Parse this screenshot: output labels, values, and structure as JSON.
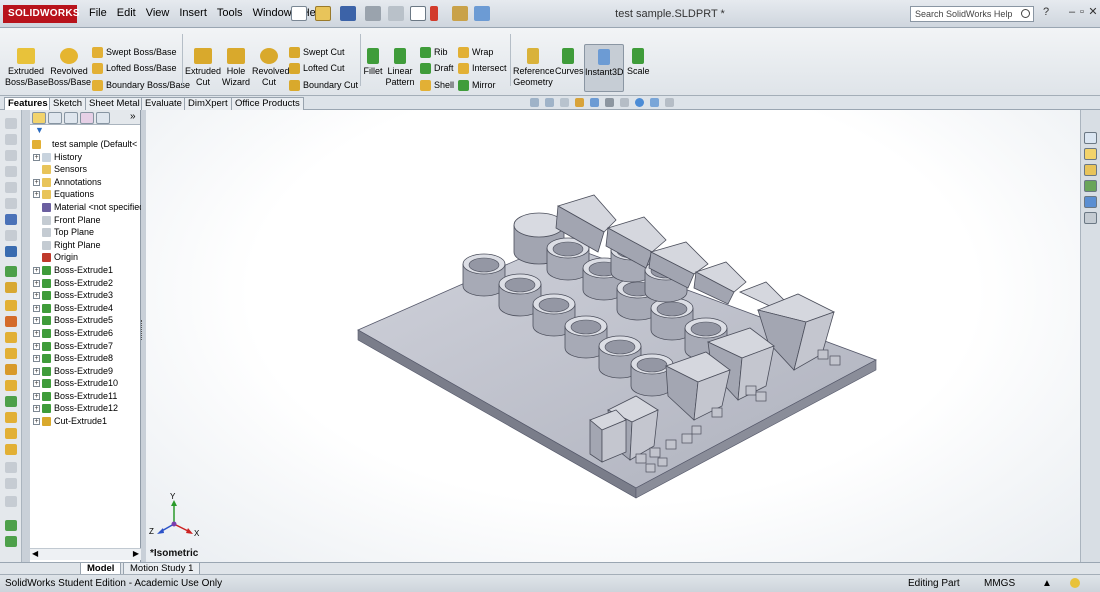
{
  "app": {
    "logo_text": "SOLIDWORKS",
    "document_title": "test sample.SLDPRT *",
    "menus": [
      "File",
      "Edit",
      "View",
      "Insert",
      "Tools",
      "Window",
      "Help"
    ],
    "help_search_placeholder": "Search SolidWorks Help"
  },
  "command_manager": {
    "extruded_boss": "Extruded Boss/Base",
    "revolved_boss": "Revolved Boss/Base",
    "swept_boss": "Swept Boss/Base",
    "lofted_boss": "Lofted Boss/Base",
    "boundary_boss": "Boundary Boss/Base",
    "extruded_cut": "Extruded Cut",
    "hole_wizard": "Hole Wizard",
    "revolved_cut": "Revolved Cut",
    "swept_cut": "Swept Cut",
    "lofted_cut": "Lofted Cut",
    "boundary_cut": "Boundary Cut",
    "fillet": "Fillet",
    "linear_pattern": "Linear Pattern",
    "rib": "Rib",
    "draft": "Draft",
    "shell": "Shell",
    "wrap": "Wrap",
    "intersect": "Intersect",
    "mirror": "Mirror",
    "reference_geometry": "Reference Geometry",
    "curves": "Curves",
    "instant3d": "Instant3D",
    "scale": "Scale"
  },
  "tabs": [
    "Features",
    "Sketch",
    "Sheet Metal",
    "Evaluate",
    "DimXpert",
    "Office Products"
  ],
  "feature_tree": {
    "root": "test sample  (Default<",
    "items": [
      {
        "label": "History",
        "icon": "history-icon",
        "expand": true
      },
      {
        "label": "Sensors",
        "icon": "sensors-icon",
        "expand": false
      },
      {
        "label": "Annotations",
        "icon": "annotations-icon",
        "expand": true
      },
      {
        "label": "Equations",
        "icon": "equations-icon",
        "expand": true
      },
      {
        "label": "Material <not specified>",
        "icon": "material-icon",
        "expand": false
      },
      {
        "label": "Front Plane",
        "icon": "plane-icon",
        "expand": false
      },
      {
        "label": "Top Plane",
        "icon": "plane-icon",
        "expand": false
      },
      {
        "label": "Right Plane",
        "icon": "plane-icon",
        "expand": false
      },
      {
        "label": "Origin",
        "icon": "origin-icon",
        "expand": false
      },
      {
        "label": "Boss-Extrude1",
        "icon": "extrude-icon",
        "expand": true
      },
      {
        "label": "Boss-Extrude2",
        "icon": "extrude-icon",
        "expand": true
      },
      {
        "label": "Boss-Extrude3",
        "icon": "extrude-icon",
        "expand": true
      },
      {
        "label": "Boss-Extrude4",
        "icon": "extrude-icon",
        "expand": true
      },
      {
        "label": "Boss-Extrude5",
        "icon": "extrude-icon",
        "expand": true
      },
      {
        "label": "Boss-Extrude6",
        "icon": "extrude-icon",
        "expand": true
      },
      {
        "label": "Boss-Extrude7",
        "icon": "extrude-icon",
        "expand": true
      },
      {
        "label": "Boss-Extrude8",
        "icon": "extrude-icon",
        "expand": true
      },
      {
        "label": "Boss-Extrude9",
        "icon": "extrude-icon",
        "expand": true
      },
      {
        "label": "Boss-Extrude10",
        "icon": "extrude-icon",
        "expand": true
      },
      {
        "label": "Boss-Extrude11",
        "icon": "extrude-icon",
        "expand": true
      },
      {
        "label": "Boss-Extrude12",
        "icon": "extrude-icon",
        "expand": true
      },
      {
        "label": "Cut-Extrude1",
        "icon": "cut-extrude-icon",
        "expand": true
      }
    ]
  },
  "viewport": {
    "view_orientation": "*Isometric",
    "axis_x": "X",
    "axis_y": "Y",
    "axis_z": "Z"
  },
  "bottom_tabs": [
    "Model",
    "Motion Study 1"
  ],
  "status": {
    "edition": "SolidWorks Student Edition - Academic Use Only",
    "mode": "Editing Part",
    "units": "MMGS"
  },
  "colors": {
    "model_top": "#c4c6d0",
    "model_side": "#7c7f8c",
    "accent": "#b8131b"
  }
}
